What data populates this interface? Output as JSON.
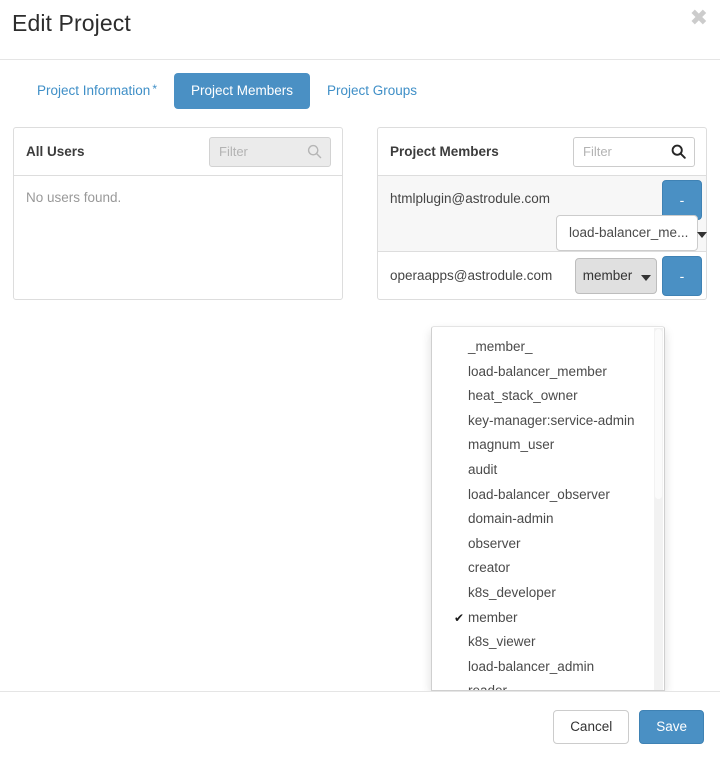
{
  "modal": {
    "title": "Edit Project",
    "close_label": "✖"
  },
  "tabs": [
    {
      "label": "Project Information",
      "required_marker": "*",
      "active": false
    },
    {
      "label": "Project Members",
      "required_marker": "",
      "active": true
    },
    {
      "label": "Project Groups",
      "required_marker": "",
      "active": false
    }
  ],
  "all_users_panel": {
    "title": "All Users",
    "filter_placeholder": "Filter",
    "filter_value": "",
    "empty_text": "No users found."
  },
  "project_members_panel": {
    "title": "Project Members",
    "filter_placeholder": "Filter",
    "filter_value": "",
    "members": [
      {
        "email": "htmlplugin@astrodule.com",
        "role": "load-balancer_me...",
        "remove_label": "-"
      },
      {
        "email": "operaapps@astrodule.com",
        "role": "member",
        "remove_label": "-"
      }
    ]
  },
  "role_dropdown": {
    "selected": "member",
    "check_glyph": "✔",
    "items": [
      "_member_",
      "load-balancer_member",
      "heat_stack_owner",
      "key-manager:service-admin",
      "magnum_user",
      "audit",
      "load-balancer_observer",
      "domain-admin",
      "observer",
      "creator",
      "k8s_developer",
      "member",
      "k8s_viewer",
      "load-balancer_admin",
      "reader"
    ]
  },
  "footer": {
    "cancel_label": "Cancel",
    "save_label": "Save"
  },
  "colors": {
    "accent": "#4a90c4",
    "link": "#3f8fc7",
    "border": "#dddddd",
    "muted_text": "#999999"
  }
}
